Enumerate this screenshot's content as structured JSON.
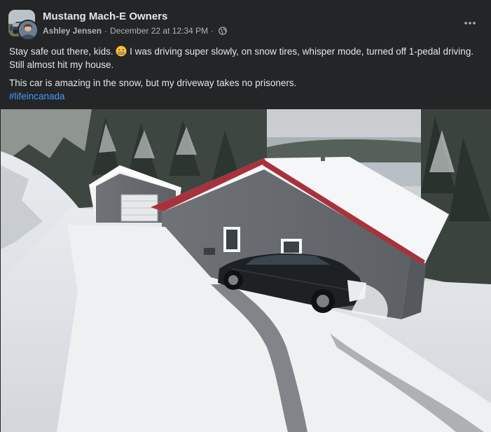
{
  "post": {
    "group_name": "Mustang Mach-E Owners",
    "author": "Ashley Jensen",
    "separator": "·",
    "date": "December 22 at 12:34 PM",
    "privacy_icon": "globe-icon",
    "more_icon": "more-options-icon",
    "text_line1_before_emoji": "Stay safe out there, kids. ",
    "emoji": "grimacing-face-emoji",
    "text_line1_after_emoji": " I was driving super slowly, on snow tires, whisper mode, turned off 1-pedal driving. Still almost hit my house.",
    "text_line2": "This car is amazing in the snow, but my driveway takes no prisoners.",
    "hashtag": "#lifeincanada"
  },
  "colors": {
    "background": "#242526",
    "primary_text": "#e4e6eb",
    "secondary_text": "#b0b3b8",
    "link": "#4599ff"
  }
}
